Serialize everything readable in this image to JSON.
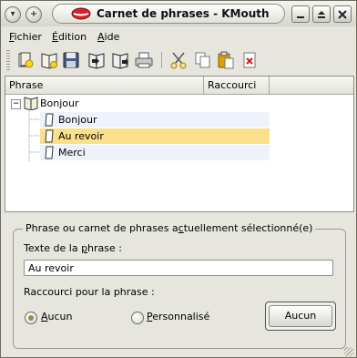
{
  "window": {
    "title": "Carnet de phrases - KMouth",
    "buttons": {
      "menu": "▾",
      "sticky": "+"
    }
  },
  "menubar": {
    "items": [
      {
        "label": "Fichier",
        "accel": "F",
        "rest": "ichier"
      },
      {
        "label": "Édition",
        "accel": "É",
        "rest": "dition"
      },
      {
        "label": "Aide",
        "accel": "A",
        "rest": "ide"
      }
    ]
  },
  "toolbar": {
    "icons": [
      "new-phrase-icon",
      "new-phrasebook-icon",
      "save-icon",
      "import-icon",
      "export-icon",
      "print-icon",
      "cut-icon",
      "copy-icon",
      "paste-icon",
      "delete-icon"
    ]
  },
  "listview": {
    "columns": [
      "Phrase",
      "Raccourci"
    ],
    "root": {
      "label": "Bonjour",
      "expander": "−"
    },
    "children": [
      {
        "label": "Bonjour",
        "selected": false
      },
      {
        "label": "Au revoir",
        "selected": true
      },
      {
        "label": "Merci",
        "selected": false
      }
    ],
    "colors": {
      "selection": "#fbe08a",
      "alt_row": "#eef3fb"
    }
  },
  "group": {
    "title_pre": "Phrase ou carnet de phrases a",
    "title_accel": "c",
    "title_post": "tuellement sélectionné(e)",
    "phrase_label_pre": "Texte de la ",
    "phrase_label_accel": "p",
    "phrase_label_post": "hrase :",
    "phrase_value": "Au revoir",
    "shortcut_label": "Raccourci pour la phrase :",
    "radio_none_accel": "A",
    "radio_none_rest": "ucun",
    "radio_custom_accel": "P",
    "radio_custom_rest": "ersonnalisé",
    "radio_selected": "none",
    "shortcut_button": "Aucun"
  }
}
